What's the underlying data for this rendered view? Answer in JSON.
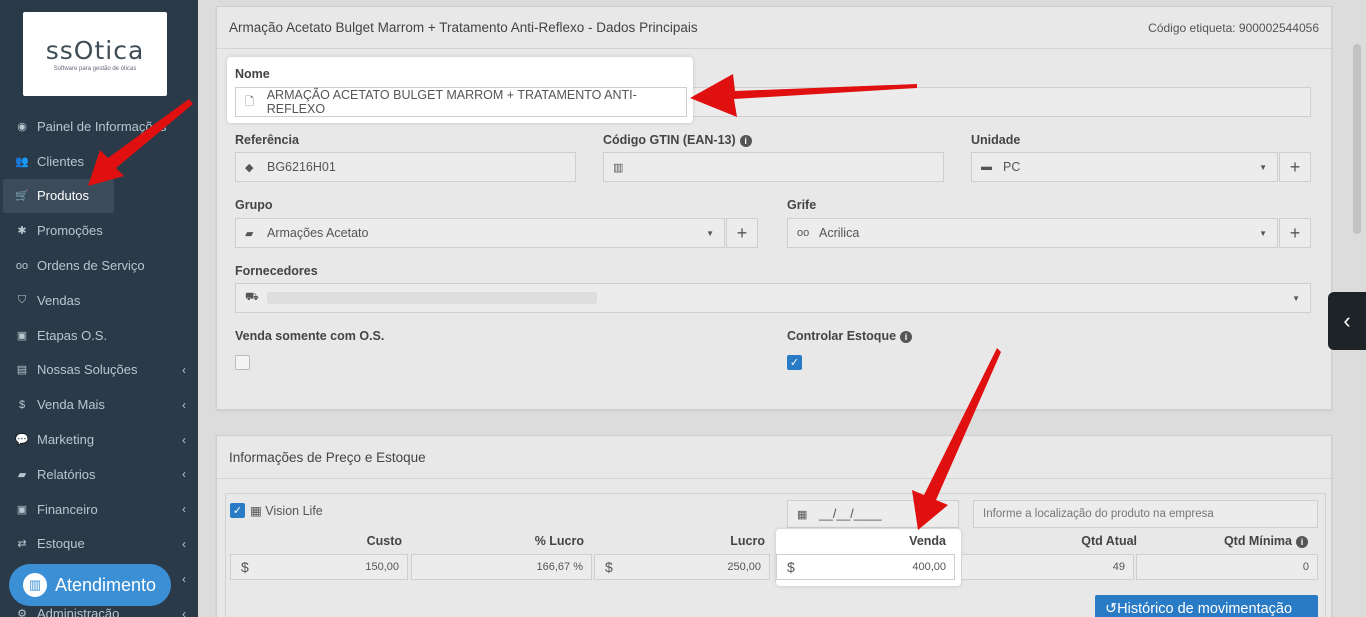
{
  "logo": {
    "brand": "ssOtica",
    "tagline": "Software para gestão de óticas"
  },
  "sidebar": {
    "items": [
      {
        "label": "Painel de Informações",
        "icon": "dashboard-icon",
        "glyph": "◉"
      },
      {
        "label": "Clientes",
        "icon": "users-icon",
        "glyph": "👥"
      },
      {
        "label": "Produtos",
        "icon": "cart-icon",
        "glyph": "🛒"
      },
      {
        "label": "Promoções",
        "icon": "asterisk-icon",
        "glyph": "✱"
      },
      {
        "label": "Ordens de Serviço",
        "icon": "glasses-icon",
        "glyph": "oo"
      },
      {
        "label": "Vendas",
        "icon": "basket-icon",
        "glyph": "⛉"
      },
      {
        "label": "Etapas O.S.",
        "icon": "money-icon",
        "glyph": "▣"
      },
      {
        "label": "Nossas Soluções",
        "icon": "briefcase-icon",
        "glyph": "▤"
      },
      {
        "label": "Venda Mais",
        "icon": "dollar-icon",
        "glyph": "$"
      },
      {
        "label": "Marketing",
        "icon": "comments-icon",
        "glyph": "💬"
      },
      {
        "label": "Relatórios",
        "icon": "folder-icon",
        "glyph": "▰"
      },
      {
        "label": "Financeiro",
        "icon": "cash-icon",
        "glyph": "▣"
      },
      {
        "label": "Estoque",
        "icon": "exchange-icon",
        "glyph": "⇄"
      },
      {
        "label": "",
        "icon": "chart-icon",
        "glyph": ""
      },
      {
        "label": "Administração",
        "icon": "cog-icon",
        "glyph": "⚙"
      }
    ],
    "chevron": "‹",
    "atendimento": "Atendimento"
  },
  "panel1": {
    "title": "Armação Acetato Bulget Marrom + Tratamento Anti-Reflexo - Dados Principais",
    "codigo": "Código etiqueta: 900002544056",
    "nome_label": "Nome",
    "nome_value": "ARMAÇÃO ACETATO BULGET MARROM + TRATAMENTO ANTI-REFLEXO",
    "referencia_label": "Referência",
    "referencia_value": "BG6216H01",
    "gtin_label": "Código GTIN (EAN-13)",
    "unidade_label": "Unidade",
    "unidade_value": "PC",
    "grupo_label": "Grupo",
    "grupo_value": "Armações Acetato",
    "grife_label": "Grife",
    "grife_value": "Acrilica",
    "fornecedores_label": "Fornecedores",
    "venda_os_label": "Venda somente com O.S.",
    "controlar_label": "Controlar Estoque"
  },
  "panel2": {
    "title": "Informações de Preço e Estoque",
    "store": "Vision Life",
    "date_placeholder": "__/__/____",
    "location_placeholder": "Informe a localização do produto na empresa",
    "headers": {
      "custo": "Custo",
      "lucro_pct": "% Lucro",
      "lucro": "Lucro",
      "venda": "Venda",
      "qtd_atual": "Qtd Atual",
      "qtd_minima": "Qtd Mínima"
    },
    "values": {
      "custo": "150,00",
      "lucro_pct": "166,67 %",
      "lucro": "250,00",
      "venda": "400,00",
      "qtd_atual": "49",
      "qtd_minima": "0"
    },
    "currency": "$",
    "historico": "Histórico de movimentação"
  },
  "colors": {
    "sidebar": "#2b3a48",
    "accent": "#2a7bc6",
    "arrow": "#e01010"
  }
}
